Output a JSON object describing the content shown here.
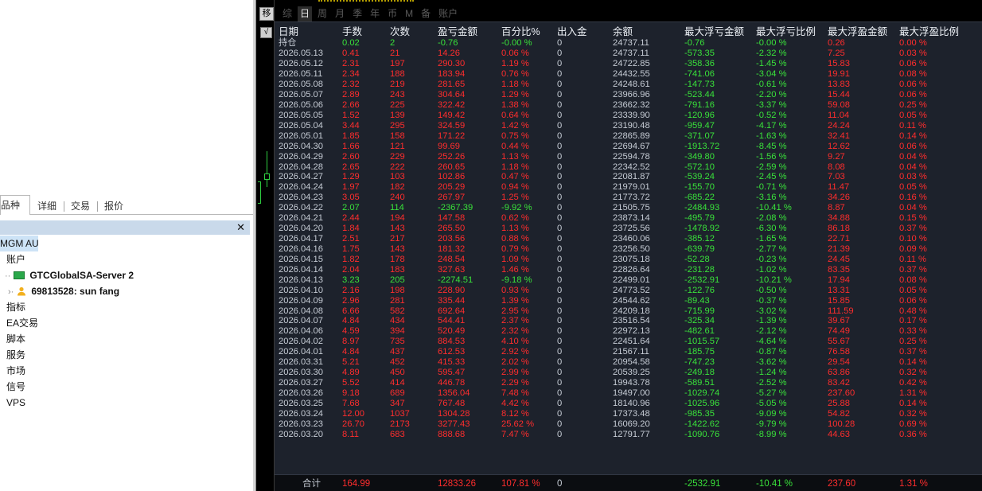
{
  "left_panel": {
    "tabs": [
      "品种",
      "详细",
      "交易",
      "报价"
    ],
    "close_glyph": "✕",
    "tree": [
      {
        "label": "MGM AU",
        "icon": "none",
        "bold": false,
        "selected": true
      },
      {
        "label": "账户",
        "icon": "accounts-icon",
        "bold": false
      },
      {
        "label": "GTCGlobalSA-Server 2",
        "icon": "server-icon",
        "bold": true
      },
      {
        "label": "69813528: sun fang",
        "icon": "user-icon",
        "bold": true
      },
      {
        "label": "指标",
        "icon": "indicators-icon",
        "bold": false
      },
      {
        "label": "EA交易",
        "icon": "expert-advisors-icon",
        "bold": false
      },
      {
        "label": "脚本",
        "icon": "scripts-icon",
        "bold": false
      },
      {
        "label": "服务",
        "icon": "services-icon",
        "bold": false
      },
      {
        "label": "市场",
        "icon": "market-icon",
        "bold": false
      },
      {
        "label": "信号",
        "icon": "signals-icon",
        "bold": false
      },
      {
        "label": "VPS",
        "icon": "vps-icon",
        "bold": false
      }
    ]
  },
  "toolbar": {
    "strip_button": "移",
    "check_button": "√",
    "periods": [
      "综",
      "日",
      "周",
      "月",
      "季",
      "年",
      "币",
      "M",
      "备",
      "账户"
    ],
    "active_period": "日"
  },
  "table": {
    "headers": [
      "日期",
      "手数",
      "次数",
      "盈亏金额",
      "百分比%",
      "出入金",
      "余额",
      "最大浮亏金额",
      "最大浮亏比例",
      "最大浮盈金额",
      "最大浮盈比例"
    ],
    "holding": {
      "date": "持仓",
      "lots": "0.02",
      "count": "2",
      "pnl": "-0.76",
      "pct": "-0.00 %",
      "flow": "0",
      "balance": "24737.11",
      "max_loss": "-0.76",
      "max_loss_pct": "-0.00 %",
      "max_gain": "0.26",
      "max_gain_pct": "0.00 %"
    },
    "rows": [
      [
        "2026.05.13",
        "0.41",
        "21",
        "14.26",
        "0.06 %",
        "0",
        "24737.11",
        "-573.35",
        "-2.32 %",
        "7.25",
        "0.03 %"
      ],
      [
        "2026.05.12",
        "2.31",
        "197",
        "290.30",
        "1.19 %",
        "0",
        "24722.85",
        "-358.36",
        "-1.45 %",
        "15.83",
        "0.06 %"
      ],
      [
        "2026.05.11",
        "2.34",
        "188",
        "183.94",
        "0.76 %",
        "0",
        "24432.55",
        "-741.06",
        "-3.04 %",
        "19.91",
        "0.08 %"
      ],
      [
        "2026.05.08",
        "2.32",
        "219",
        "281.65",
        "1.18 %",
        "0",
        "24248.61",
        "-147.73",
        "-0.61 %",
        "13.83",
        "0.06 %"
      ],
      [
        "2026.05.07",
        "2.89",
        "243",
        "304.64",
        "1.29 %",
        "0",
        "23966.96",
        "-523.44",
        "-2.20 %",
        "15.44",
        "0.06 %"
      ],
      [
        "2026.05.06",
        "2.66",
        "225",
        "322.42",
        "1.38 %",
        "0",
        "23662.32",
        "-791.16",
        "-3.37 %",
        "59.08",
        "0.25 %"
      ],
      [
        "2026.05.05",
        "1.52",
        "139",
        "149.42",
        "0.64 %",
        "0",
        "23339.90",
        "-120.96",
        "-0.52 %",
        "11.04",
        "0.05 %"
      ],
      [
        "2026.05.04",
        "3.44",
        "295",
        "324.59",
        "1.42 %",
        "0",
        "23190.48",
        "-959.47",
        "-4.17 %",
        "24.24",
        "0.11 %"
      ],
      [
        "2026.05.01",
        "1.85",
        "158",
        "171.22",
        "0.75 %",
        "0",
        "22865.89",
        "-371.07",
        "-1.63 %",
        "32.41",
        "0.14 %"
      ],
      [
        "2026.04.30",
        "1.66",
        "121",
        "99.69",
        "0.44 %",
        "0",
        "22694.67",
        "-1913.72",
        "-8.45 %",
        "12.62",
        "0.06 %"
      ],
      [
        "2026.04.29",
        "2.60",
        "229",
        "252.26",
        "1.13 %",
        "0",
        "22594.78",
        "-349.80",
        "-1.56 %",
        "9.27",
        "0.04 %"
      ],
      [
        "2026.04.28",
        "2.65",
        "222",
        "260.65",
        "1.18 %",
        "0",
        "22342.52",
        "-572.10",
        "-2.59 %",
        "8.08",
        "0.04 %"
      ],
      [
        "2026.04.27",
        "1.29",
        "103",
        "102.86",
        "0.47 %",
        "0",
        "22081.87",
        "-539.24",
        "-2.45 %",
        "7.03",
        "0.03 %"
      ],
      [
        "2026.04.24",
        "1.97",
        "182",
        "205.29",
        "0.94 %",
        "0",
        "21979.01",
        "-155.70",
        "-0.71 %",
        "11.47",
        "0.05 %"
      ],
      [
        "2026.04.23",
        "3.05",
        "240",
        "267.97",
        "1.25 %",
        "0",
        "21773.72",
        "-685.22",
        "-3.16 %",
        "34.26",
        "0.16 %"
      ],
      [
        "2026.04.22",
        "2.07",
        "114",
        "-2367.39",
        "-9.92 %",
        "0",
        "21505.75",
        "-2484.93",
        "-10.41 %",
        "8.87",
        "0.04 %"
      ],
      [
        "2026.04.21",
        "2.44",
        "194",
        "147.58",
        "0.62 %",
        "0",
        "23873.14",
        "-495.79",
        "-2.08 %",
        "34.88",
        "0.15 %"
      ],
      [
        "2026.04.20",
        "1.84",
        "143",
        "265.50",
        "1.13 %",
        "0",
        "23725.56",
        "-1478.92",
        "-6.30 %",
        "86.18",
        "0.37 %"
      ],
      [
        "2026.04.17",
        "2.51",
        "217",
        "203.56",
        "0.88 %",
        "0",
        "23460.06",
        "-385.12",
        "-1.65 %",
        "22.71",
        "0.10 %"
      ],
      [
        "2026.04.16",
        "1.75",
        "143",
        "181.32",
        "0.79 %",
        "0",
        "23256.50",
        "-639.79",
        "-2.77 %",
        "21.39",
        "0.09 %"
      ],
      [
        "2026.04.15",
        "1.82",
        "178",
        "248.54",
        "1.09 %",
        "0",
        "23075.18",
        "-52.28",
        "-0.23 %",
        "24.45",
        "0.11 %"
      ],
      [
        "2026.04.14",
        "2.04",
        "183",
        "327.63",
        "1.46 %",
        "0",
        "22826.64",
        "-231.28",
        "-1.02 %",
        "83.35",
        "0.37 %"
      ],
      [
        "2026.04.13",
        "3.23",
        "205",
        "-2274.51",
        "-9.18 %",
        "0",
        "22499.01",
        "-2532.91",
        "-10.21 %",
        "17.94",
        "0.08 %"
      ],
      [
        "2026.04.10",
        "2.16",
        "198",
        "228.90",
        "0.93 %",
        "0",
        "24773.52",
        "-122.76",
        "-0.50 %",
        "13.31",
        "0.05 %"
      ],
      [
        "2026.04.09",
        "2.96",
        "281",
        "335.44",
        "1.39 %",
        "0",
        "24544.62",
        "-89.43",
        "-0.37 %",
        "15.85",
        "0.06 %"
      ],
      [
        "2026.04.08",
        "6.66",
        "582",
        "692.64",
        "2.95 %",
        "0",
        "24209.18",
        "-715.99",
        "-3.02 %",
        "111.59",
        "0.48 %"
      ],
      [
        "2026.04.07",
        "4.84",
        "434",
        "544.41",
        "2.37 %",
        "0",
        "23516.54",
        "-325.34",
        "-1.39 %",
        "39.67",
        "0.17 %"
      ],
      [
        "2026.04.06",
        "4.59",
        "394",
        "520.49",
        "2.32 %",
        "0",
        "22972.13",
        "-482.61",
        "-2.12 %",
        "74.49",
        "0.33 %"
      ],
      [
        "2026.04.02",
        "8.97",
        "735",
        "884.53",
        "4.10 %",
        "0",
        "22451.64",
        "-1015.57",
        "-4.64 %",
        "55.67",
        "0.25 %"
      ],
      [
        "2026.04.01",
        "4.84",
        "437",
        "612.53",
        "2.92 %",
        "0",
        "21567.11",
        "-185.75",
        "-0.87 %",
        "76.58",
        "0.37 %"
      ],
      [
        "2026.03.31",
        "5.21",
        "452",
        "415.33",
        "2.02 %",
        "0",
        "20954.58",
        "-747.23",
        "-3.62 %",
        "29.54",
        "0.14 %"
      ],
      [
        "2026.03.30",
        "4.89",
        "450",
        "595.47",
        "2.99 %",
        "0",
        "20539.25",
        "-249.18",
        "-1.24 %",
        "63.86",
        "0.32 %"
      ],
      [
        "2026.03.27",
        "5.52",
        "414",
        "446.78",
        "2.29 %",
        "0",
        "19943.78",
        "-589.51",
        "-2.52 %",
        "83.42",
        "0.42 %"
      ],
      [
        "2026.03.26",
        "9.18",
        "689",
        "1356.04",
        "7.48 %",
        "0",
        "19497.00",
        "-1029.74",
        "-5.27 %",
        "237.60",
        "1.31 %"
      ],
      [
        "2026.03.25",
        "7.68",
        "347",
        "767.48",
        "4.42 %",
        "0",
        "18140.96",
        "-1025.96",
        "-5.05 %",
        "25.88",
        "0.14 %"
      ],
      [
        "2026.03.24",
        "12.00",
        "1037",
        "1304.28",
        "8.12 %",
        "0",
        "17373.48",
        "-985.35",
        "-9.09 %",
        "54.82",
        "0.32 %"
      ],
      [
        "2026.03.23",
        "26.70",
        "2173",
        "3277.43",
        "25.62 %",
        "0",
        "16069.20",
        "-1422.62",
        "-9.79 %",
        "100.28",
        "0.69 %"
      ],
      [
        "2026.03.20",
        "8.11",
        "683",
        "888.68",
        "7.47 %",
        "0",
        "12791.77",
        "-1090.76",
        "-8.99 %",
        "44.63",
        "0.36 %"
      ]
    ],
    "total": {
      "label": "合计",
      "lots": "164.99",
      "pnl": "12833.26",
      "pct": "107.81 %",
      "flow": "0",
      "max_loss": "-2532.91",
      "max_loss_pct": "-10.41 %",
      "max_gain": "237.60",
      "max_gain_pct": "1.31 %"
    }
  },
  "colors": {
    "positive": "#ff2d2d",
    "negative": "#39e13a",
    "table_bg": "#1d222c",
    "header_text": "#eef2f7"
  }
}
